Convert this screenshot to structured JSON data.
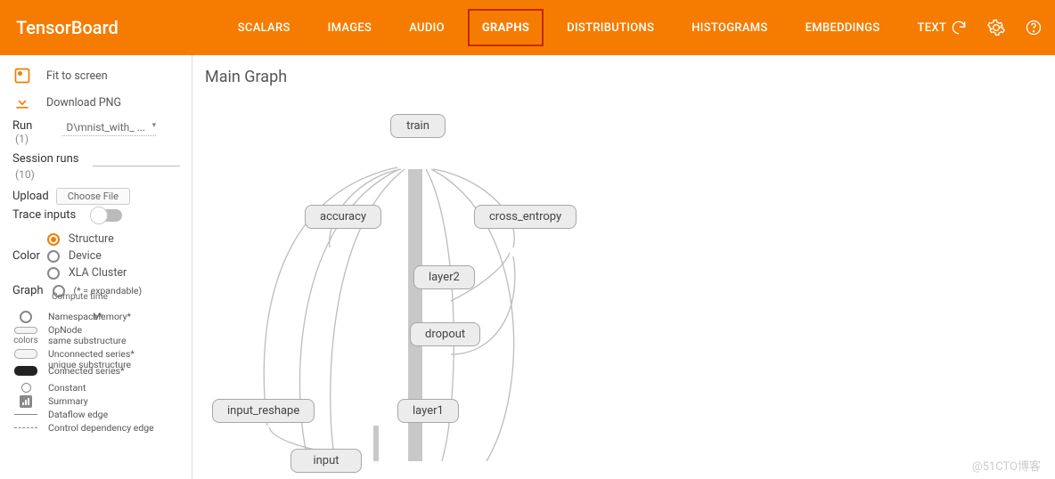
{
  "header": {
    "logo": "TensorBoard",
    "tabs": [
      "SCALARS",
      "IMAGES",
      "AUDIO",
      "GRAPHS",
      "DISTRIBUTIONS",
      "HISTOGRAMS",
      "EMBEDDINGS",
      "TEXT"
    ],
    "active_tab": "GRAPHS"
  },
  "sidebar": {
    "fit_label": "Fit to screen",
    "download_label": "Download PNG",
    "run_label": "Run",
    "run_count": "(1)",
    "run_value": "D\\mnist_with_ ...",
    "session_label": "Session runs",
    "session_count": "(10)",
    "upload_label": "Upload",
    "choose_file": "Choose File",
    "trace_label": "Trace inputs",
    "color_label": "Color",
    "color_options": [
      "Structure",
      "Device",
      "XLA Cluster"
    ],
    "color_selected": "Structure",
    "graph_label": "Graph",
    "graph_legend_a": "(* = expandable)",
    "graph_legend_b": "Namespace*",
    "graph_legend_c": "OpNode",
    "graph_legend_d": "Unconnected series*",
    "graph_legend_e": "Connected series*",
    "graph_legend_colors": "colors",
    "graph_legend_same": "same substructure",
    "graph_legend_unique": "unique substructure",
    "graph_legend_compute": "Compute time",
    "graph_legend_memory": "Memory*",
    "legend_items": [
      {
        "sym": "circle",
        "label": "Constant"
      },
      {
        "sym": "box",
        "label": "Summary"
      },
      {
        "sym": "line",
        "label": "Dataflow edge"
      },
      {
        "sym": "dash",
        "label": "Control dependency edge"
      }
    ]
  },
  "main": {
    "title": "Main Graph",
    "nodes": {
      "train": "train",
      "accuracy": "accuracy",
      "cross_entropy": "cross_entropy",
      "layer2": "layer2",
      "dropout": "dropout",
      "input_reshape": "input_reshape",
      "layer1": "layer1",
      "input": "input"
    }
  },
  "watermark": "@51CTO博客"
}
